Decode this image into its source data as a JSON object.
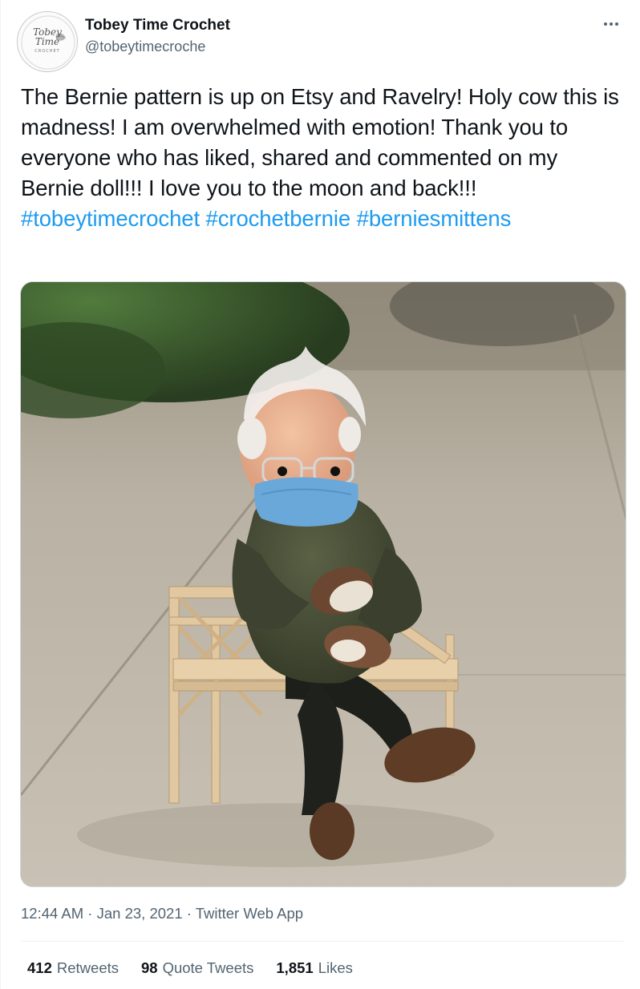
{
  "user": {
    "display_name": "Tobey Time Crochet",
    "handle": "@tobeytimecroche",
    "avatar_text_line1": "Tobey",
    "avatar_text_line2": "Time",
    "avatar_text_line3": "CROCHET"
  },
  "menu": {
    "icon": "more-horizontal-icon"
  },
  "tweet": {
    "text_segments": [
      {
        "text": "The Bernie pattern is up on Etsy and Ravelry! Holy cow this is madness! I am overwhelmed with emotion! Thank you to everyone who has liked, shared and commented on my Bernie doll!!! I love you to the moon and back!!! ",
        "type": "plain"
      },
      {
        "text": "#tobeytimecrochet",
        "type": "hashtag"
      },
      {
        "text": " ",
        "type": "plain"
      },
      {
        "text": "#crochetbernie",
        "type": "hashtag"
      },
      {
        "text": " ",
        "type": "plain"
      },
      {
        "text": "#berniesmittens",
        "type": "hashtag"
      }
    ],
    "time": "12:44 AM",
    "separator": " · ",
    "date": "Jan 23, 2021",
    "source": "Twitter Web App"
  },
  "stats": {
    "retweets_count": "412",
    "retweets_label": "Retweets",
    "quotes_count": "98",
    "quotes_label": "Quote Tweets",
    "likes_count": "1,851",
    "likes_label": "Likes"
  },
  "colors": {
    "link": "#1d9bf0",
    "text_primary": "#0f1419",
    "text_secondary": "#536471"
  }
}
